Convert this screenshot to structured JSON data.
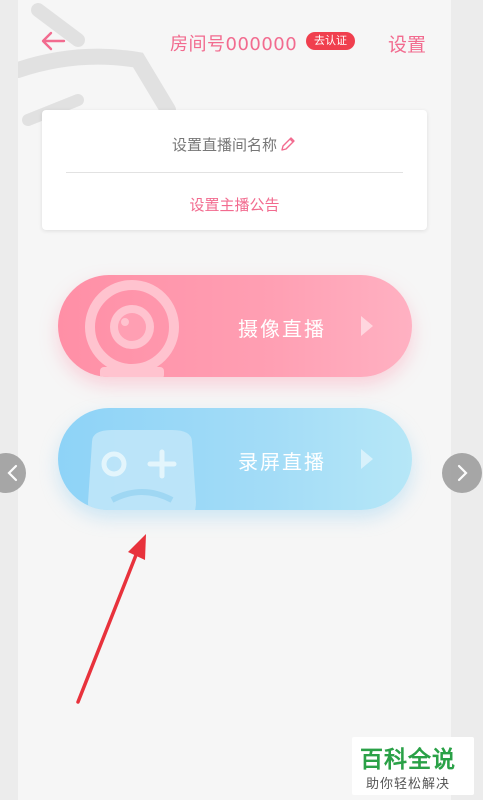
{
  "header": {
    "room_label": "房间号000000",
    "verify_badge": "去认证",
    "settings_label": "设置"
  },
  "card": {
    "name_label": "设置直播间名称",
    "notice_label": "设置主播公告"
  },
  "modes": {
    "camera_label": "摄像直播",
    "screen_label": "录屏直播"
  },
  "watermark": {
    "title": "百科全说",
    "subtitle": "助你轻松解决"
  },
  "colors": {
    "accent_pink": "#f26b8f",
    "badge_red": "#f03f4e",
    "camera_button": "#ff8fa6",
    "screen_button": "#8ed3f7",
    "annotation_arrow": "#e8323c",
    "watermark_green": "#2aa147"
  },
  "icons": {
    "back": "back-arrow-icon",
    "edit": "pencil-icon",
    "camera": "webcam-icon",
    "gamepad": "gamepad-icon",
    "play": "play-triangle-icon",
    "prev": "chevron-left-icon",
    "next": "chevron-right-icon"
  }
}
